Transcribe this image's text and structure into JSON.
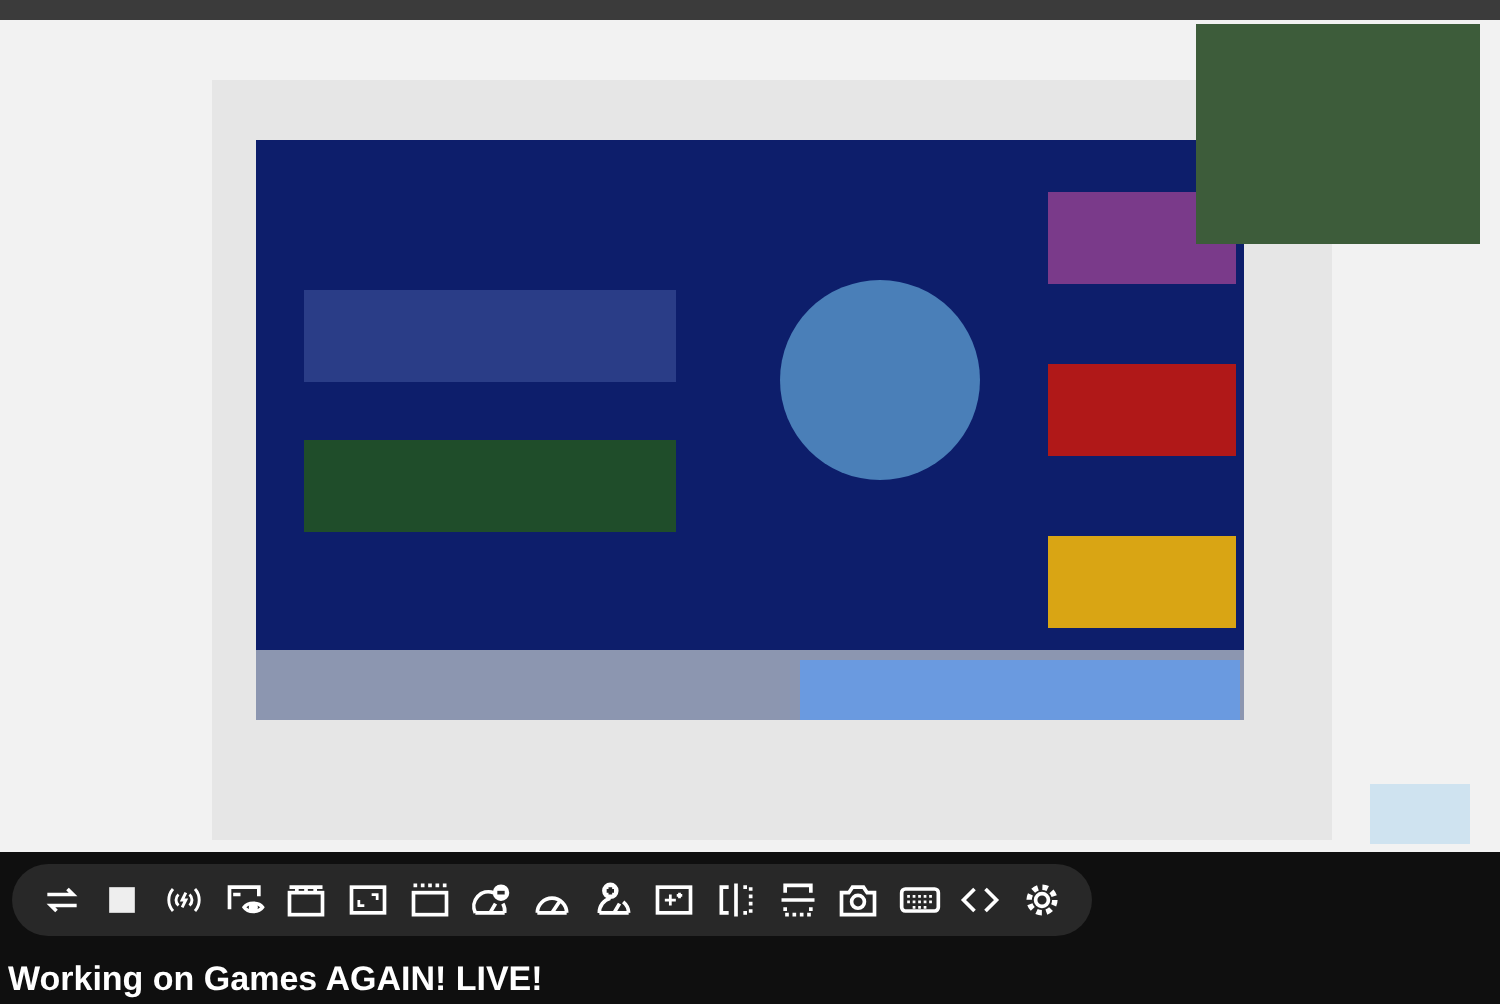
{
  "title": "Working on Games AGAIN! LIVE!"
}
